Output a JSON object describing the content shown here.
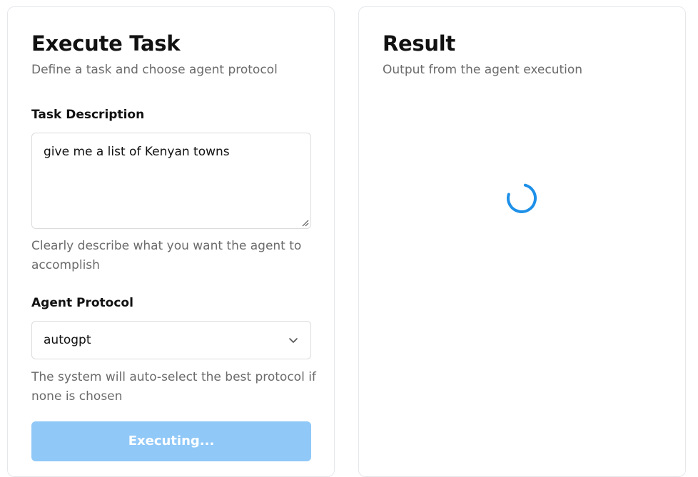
{
  "task_card": {
    "title": "Execute Task",
    "subtitle": "Define a task and choose agent protocol",
    "task_label": "Task Description",
    "task_value": "give me a list of Kenyan towns",
    "task_help": "Clearly describe what you want the agent to accomplish",
    "protocol_label": "Agent Protocol",
    "protocol_value": "autogpt",
    "protocol_help": "The system will auto-select the best protocol if none is chosen",
    "button_label": "Executing..."
  },
  "result_card": {
    "title": "Result",
    "subtitle": "Output from the agent execution",
    "state": "loading"
  },
  "colors": {
    "accent": "#1e90e8",
    "button_disabled": "#90c8f8",
    "muted_text": "#6b6b6b",
    "border": "#e5e7eb"
  },
  "icons": {
    "select_chevron": "chevron-down-icon",
    "loading": "loading-spinner-icon",
    "resize": "resize-grip-icon"
  }
}
